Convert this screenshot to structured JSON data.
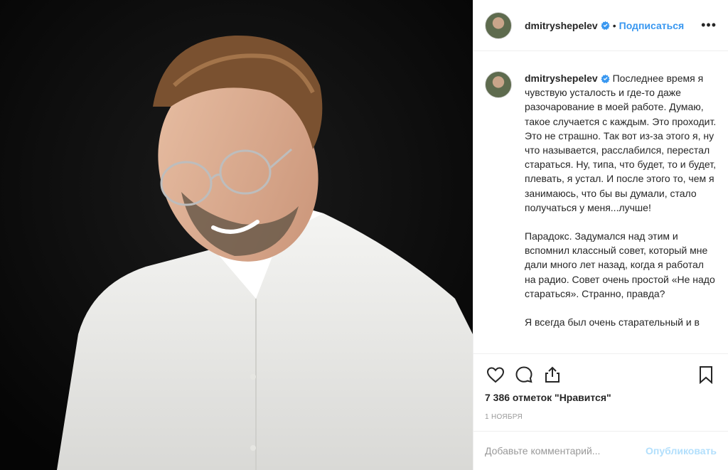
{
  "post": {
    "username": "dmitryshepelev",
    "verified": true,
    "separator": "•",
    "follow_label": "Подписаться",
    "more_label": "•••"
  },
  "caption": {
    "author": "dmitryshepelev",
    "paragraphs": [
      "Последнее время я чувствую усталость и где-то даже разочарование в моей работе. Думаю, такое случается с каждым. Это проходит. Это не страшно. Так вот из-за этого я, ну что называется, расслабился, перестал стараться. Ну, типа, что будет, то и будет, плевать, я устал. И после этого то, чем я занимаюсь, что бы вы думали, стало получаться у меня...лучше!",
      "Парадокс. Задумался над этим и вспомнил классный совет, который мне дали много лет назад, когда я работал на радио. Совет очень простой «Не надо стараться». Странно, правда?",
      "Я всегда был очень старательный и в"
    ]
  },
  "stats": {
    "likes": "7 386 отметок \"Нравится\"",
    "date": "1 ноября"
  },
  "comment_box": {
    "placeholder": "Добавьте комментарий...",
    "publish_label": "Опубликовать"
  },
  "icons": {
    "like": "heart-icon",
    "comment": "comment-bubble-icon",
    "share": "share-icon",
    "save": "bookmark-icon",
    "verified": "verified-badge-icon"
  },
  "colors": {
    "accent": "#3897f0",
    "publish_disabled": "#b2dffc",
    "verified": "#3897f0"
  }
}
